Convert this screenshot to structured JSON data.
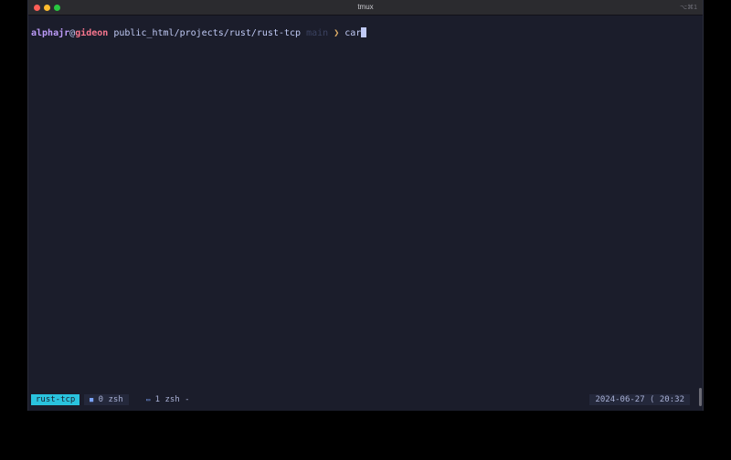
{
  "window": {
    "title": "tmux",
    "shortcut": "⌥⌘1"
  },
  "prompt": {
    "user": "alphajr",
    "at": "@",
    "host": "gideon",
    "path": "public_html/projects/rust/rust-tcp",
    "branch": "main",
    "arrow": "❯",
    "command": "car"
  },
  "statusbar": {
    "session": "rust-tcp",
    "windows": [
      {
        "icon": "terminal-icon",
        "glyph": "■",
        "label": "0 zsh"
      },
      {
        "icon": "terminal-icon",
        "glyph": "▭",
        "label": "1 zsh -"
      }
    ],
    "datetime": "2024-06-27 ⟨ 20:32"
  },
  "colors": {
    "background": "#1b1d2b",
    "user": "#bb9af7",
    "host": "#f7768e",
    "session_badge": "#2ac3de",
    "arrow": "#e0af68"
  }
}
